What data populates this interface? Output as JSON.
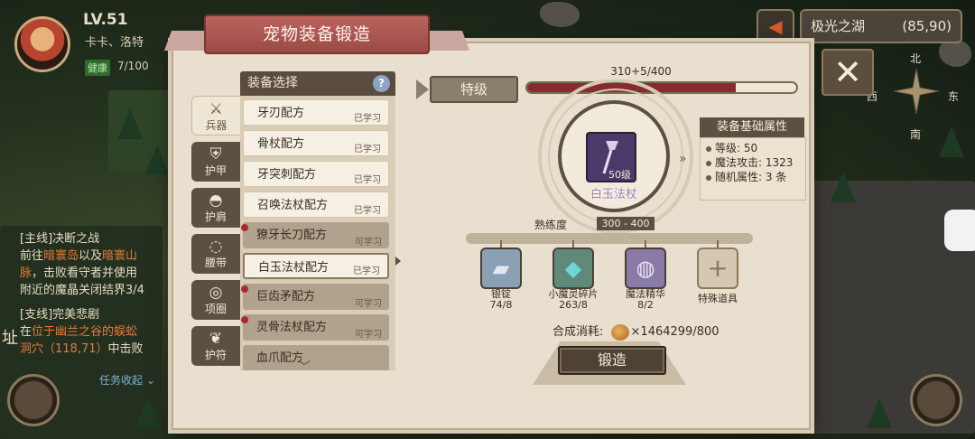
{
  "player": {
    "level": "LV.51",
    "name": "卡卡、洛特",
    "health_label": "健康",
    "health_value": "7/100"
  },
  "quests": {
    "main_tag": "[主线]决断之战",
    "main_line1_a": "前往",
    "main_line1_h1": "暗寰岛",
    "main_line1_b": "以及",
    "main_line1_h2": "暗寰山",
    "main_line2_h": "脉",
    "main_line2_b": "，击败看守者并使用",
    "main_line3": "附近的魔晶关闭结界3/4",
    "side_tag": "[支线]完美悲剧",
    "side_line1_a": "在",
    "side_line1_h": "位于幽兰之谷的蜈蚣",
    "side_line2_h": "洞穴（118,71）",
    "side_line2_b": "中击败",
    "toggle": "任务收起",
    "edge_char": "址"
  },
  "location": {
    "name": "极光之湖",
    "coord": "(85,90)"
  },
  "compass": {
    "n": "北",
    "e": "东",
    "w": "西",
    "s": "南"
  },
  "dialog": {
    "title": "宠物装备锻造",
    "close_label": "✕"
  },
  "tabs": [
    {
      "label": "兵器",
      "icon": "sword-icon",
      "active": true
    },
    {
      "label": "护甲",
      "icon": "armor-icon"
    },
    {
      "label": "护肩",
      "icon": "shoulder-icon"
    },
    {
      "label": "腰带",
      "icon": "belt-icon"
    },
    {
      "label": "项圈",
      "icon": "collar-icon"
    },
    {
      "label": "护符",
      "icon": "amulet-icon"
    }
  ],
  "list": {
    "header": "装备选择",
    "help": "?",
    "recipes": [
      {
        "name": "牙刃配方",
        "status": "已学习",
        "state": "learned",
        "dot": false
      },
      {
        "name": "骨杖配方",
        "status": "已学习",
        "state": "learned",
        "dot": false
      },
      {
        "name": "牙突刺配方",
        "status": "已学习",
        "state": "learned",
        "dot": false
      },
      {
        "name": "召唤法杖配方",
        "status": "已学习",
        "state": "learned",
        "dot": false
      },
      {
        "name": "獠牙长刀配方",
        "status": "可学习",
        "state": "learnable",
        "dot": true
      },
      {
        "name": "白玉法杖配方",
        "status": "已学习",
        "state": "selected",
        "dot": false
      },
      {
        "name": "巨齿矛配方",
        "status": "可学习",
        "state": "learnable",
        "dot": true
      },
      {
        "name": "灵骨法杖配方",
        "status": "可学习",
        "state": "learnable",
        "dot": true
      },
      {
        "name": "血爪配方",
        "status": "",
        "state": "learnable",
        "dot": false
      }
    ]
  },
  "grade": {
    "label": "特级",
    "progress_text": "310+5/400",
    "progress_fraction": 0.775
  },
  "item": {
    "name": "白玉法杖",
    "level": "50级"
  },
  "attributes": {
    "title": "装备基础属性",
    "rows": [
      "等级: 50",
      "魔法攻击: 1323",
      "随机属性: 3 条"
    ]
  },
  "proficiency": {
    "label": "熟练度",
    "value": "300 - 400"
  },
  "materials": [
    {
      "name": "银锭",
      "count": "74/8",
      "icon": "silver-ingot-icon"
    },
    {
      "name": "小魔灵碎片",
      "count": "263/8",
      "icon": "crystal-shard-icon"
    },
    {
      "name": "魔法精华",
      "count": "8/2",
      "icon": "magic-essence-icon"
    },
    {
      "name": "特殊道具",
      "count": "",
      "icon": "add-icon"
    }
  ],
  "cost": {
    "label": "合成消耗:",
    "value": "×1464299/800"
  },
  "forge_label": "锻造",
  "colors": {
    "accent_red": "#8a2a2e",
    "ribbon": "#b9645f",
    "panel": "#e8dfcf",
    "dark": "#5c5043"
  }
}
